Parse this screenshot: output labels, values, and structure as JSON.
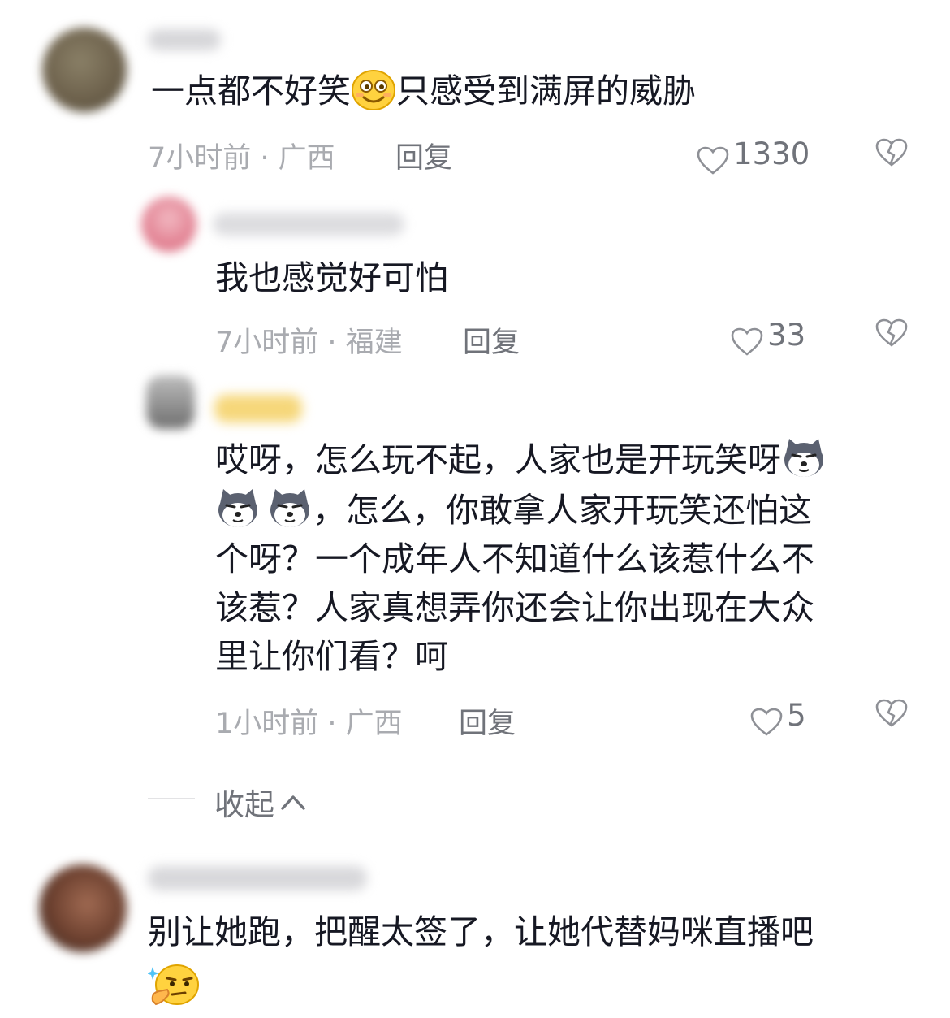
{
  "comments": [
    {
      "text_pre": "一点都不好笑",
      "text_post": "只感受到满屏的威胁",
      "emoji": "smile-face-emoji",
      "meta": "7小时前 · 广西",
      "reply": "回复",
      "likes": "1330"
    },
    {
      "text": "我也感觉好可怕",
      "meta": "7小时前 · 福建",
      "reply": "回复",
      "likes": "33"
    },
    {
      "line1": "哎呀，怎么玩不起，人家也是开玩笑呀",
      "line2": "，怎么，你敢拿人家开玩笑还怕这",
      "line3": "个呀？一个成年人不知道什么该惹什么不",
      "line4": "该惹？人家真想弄你还会让你出现在大众",
      "line5": "里让你们看？呵",
      "emoji": "husky-dog-emoji",
      "meta": "1小时前 · 广西",
      "reply": "回复",
      "likes": "5"
    },
    {
      "text": "别让她跑，把醒太签了，让她代替妈咪直播吧",
      "emoji": "thinking-face-emoji"
    }
  ],
  "collapse": {
    "label": "收起"
  },
  "colors": {
    "text": "#161823",
    "meta": "#a9abb0",
    "action": "#70737a",
    "divider": "#e3e3e5"
  }
}
